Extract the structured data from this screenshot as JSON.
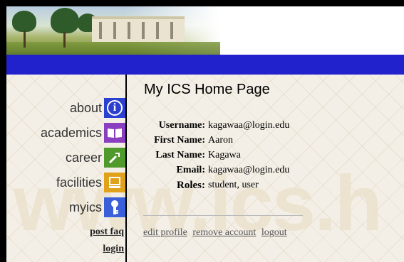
{
  "page": {
    "title": "My ICS Home Page"
  },
  "nav": {
    "items": [
      {
        "label": "about",
        "icon": "info-icon"
      },
      {
        "label": "academics",
        "icon": "book-icon"
      },
      {
        "label": "career",
        "icon": "tool-icon"
      },
      {
        "label": "facilities",
        "icon": "computer-icon"
      },
      {
        "label": "myics",
        "icon": "key-icon"
      }
    ],
    "links": [
      "post faq",
      "login"
    ]
  },
  "watermark": "www.ics.h",
  "profile": {
    "rows": [
      {
        "label": "Username:",
        "value": "kagawaa@login.edu"
      },
      {
        "label": "First Name:",
        "value": "Aaron"
      },
      {
        "label": "Last Name:",
        "value": "Kagawa"
      },
      {
        "label": "Email:",
        "value": "kagawaa@login.edu"
      },
      {
        "label": "Roles:",
        "value": "student, user"
      }
    ]
  },
  "actions": [
    "edit profile",
    "remove account",
    "logout"
  ],
  "colors": {
    "bar": "#2222cc",
    "about": "#2b3fd0",
    "academics": "#8a3fc0",
    "career": "#4f9a2a",
    "facilities": "#e0a21a",
    "myics": "#3a5fd8"
  }
}
